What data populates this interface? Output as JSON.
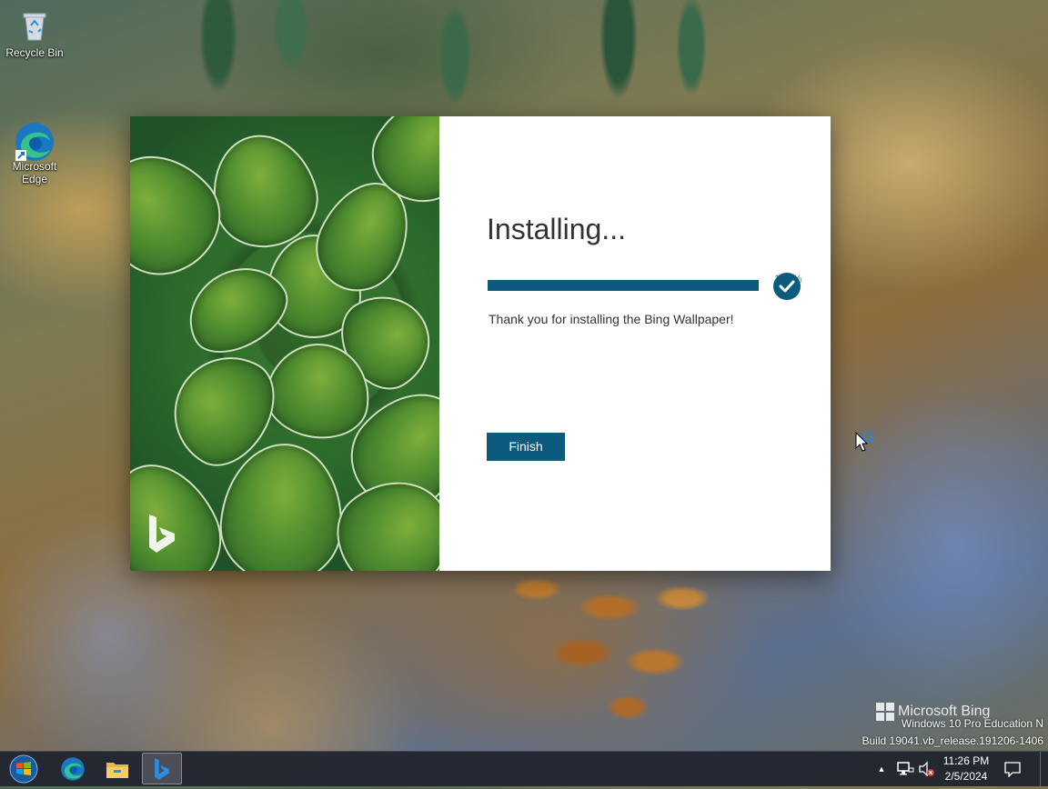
{
  "desktop": {
    "icons": [
      {
        "label": "Recycle Bin",
        "icon": "recycle-bin-icon"
      },
      {
        "label": "Microsoft\nEdge",
        "icon": "edge-icon"
      }
    ]
  },
  "installer": {
    "title": "Installing...",
    "progress_percent": 100,
    "progress_label": "100%",
    "message": "Thank you for installing the Bing Wallpaper!",
    "finish_label": "Finish",
    "accent_color": "#0c5a7e",
    "hero_icon": "bing-logo-icon"
  },
  "watermark": {
    "brand": "Microsoft Bing",
    "edition": "Windows 10 Pro Education N",
    "build": "Build 19041.vb_release.191206-1406"
  },
  "taskbar": {
    "start_icon": "windows-start-icon",
    "pinned": [
      {
        "name": "edge-icon"
      },
      {
        "name": "file-explorer-icon"
      },
      {
        "name": "bing-wallpaper-icon",
        "active": true
      }
    ],
    "tray_icons": [
      "show-hidden-icons-chevron",
      "network-icon",
      "volume-muted-icon"
    ],
    "time": "11:26 PM",
    "date": "2/5/2024",
    "notification_icon": "action-center-icon"
  }
}
